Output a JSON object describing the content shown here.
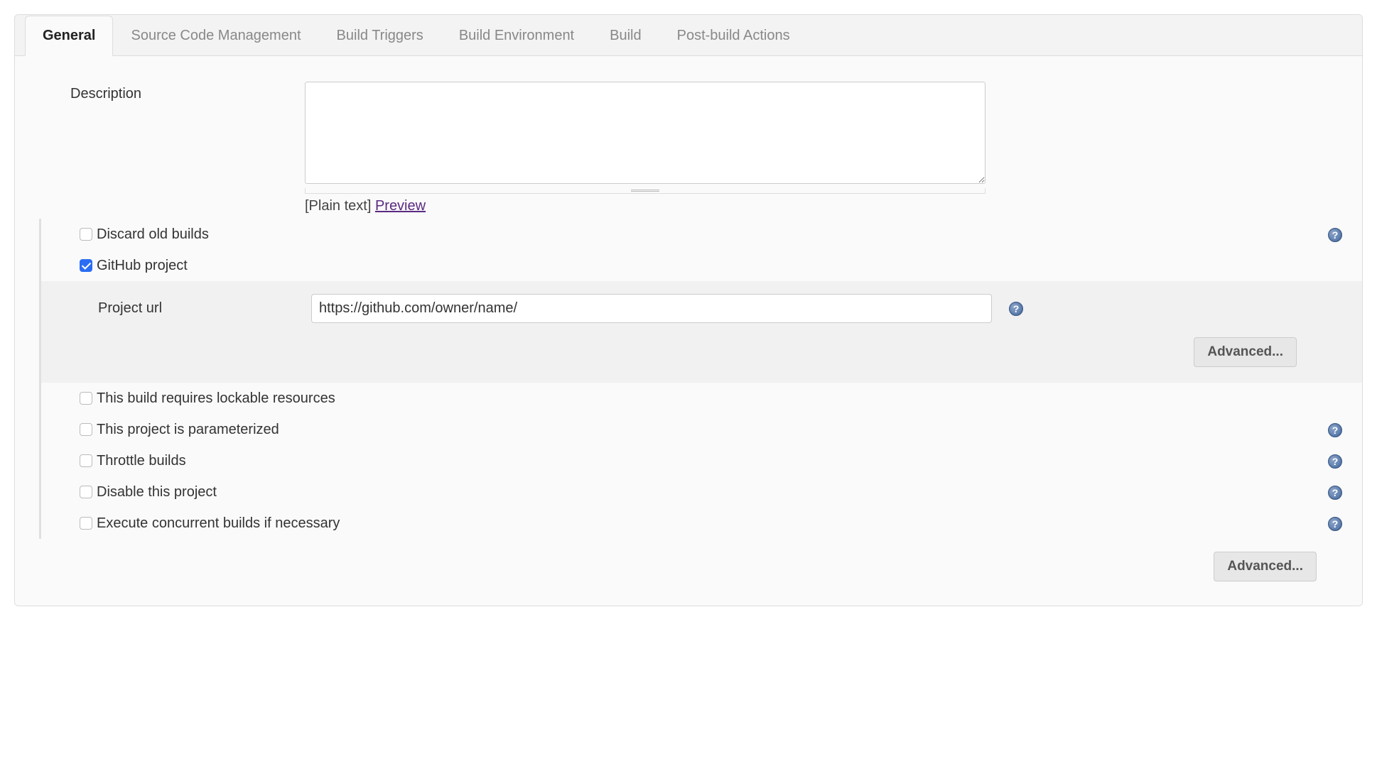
{
  "tabs": {
    "general": "General",
    "scm": "Source Code Management",
    "triggers": "Build Triggers",
    "env": "Build Environment",
    "build": "Build",
    "post": "Post-build Actions"
  },
  "general": {
    "description_label": "Description",
    "description_value": "",
    "plain_text": "[Plain text] ",
    "preview": "Preview",
    "discard_old_builds": "Discard old builds",
    "github_project": "GitHub project",
    "project_url_label": "Project url",
    "project_url_value": "https://github.com/owner/name/",
    "advanced": "Advanced...",
    "lockable": "This build requires lockable resources",
    "parameterized": "This project is parameterized",
    "throttle": "Throttle builds",
    "disable": "Disable this project",
    "concurrent": "Execute concurrent builds if necessary",
    "advanced2": "Advanced..."
  }
}
